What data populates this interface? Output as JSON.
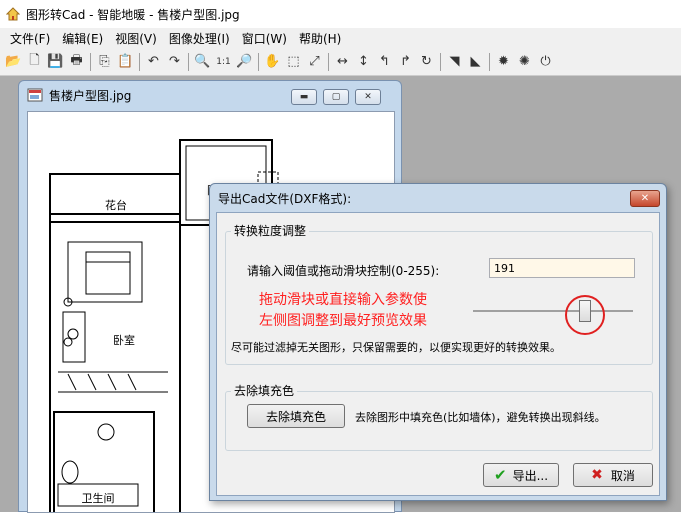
{
  "app": {
    "title": "图形转Cad - 智能地暖 - 售楼户型图.jpg"
  },
  "menu": [
    {
      "label": "文件(F)"
    },
    {
      "label": "编辑(E)"
    },
    {
      "label": "视图(V)"
    },
    {
      "label": "图像处理(I)"
    },
    {
      "label": "窗口(W)"
    },
    {
      "label": "帮助(H)"
    }
  ],
  "toolbar": {
    "icons": [
      "open-icon",
      "new-icon",
      "save-icon",
      "print-icon",
      "copy-icon",
      "paste-icon",
      "undo-icon",
      "redo-icon",
      "zoom-in-icon",
      "actual-size-icon",
      "zoom-out-icon",
      "pan-icon",
      "select-rect-icon",
      "fit-icon",
      "flip-horizontal-icon",
      "flip-vertical-icon",
      "rotate-left-icon",
      "rotate-right-icon",
      "rotate-icon",
      "crop-icon",
      "fill-icon",
      "brightness-icon",
      "contrast-icon",
      "more-icon"
    ],
    "icon_glyphs": [
      "📂",
      "🗋",
      "💾",
      "🖶",
      "⎘",
      "📋",
      "↶",
      "↷",
      "🔍",
      "1:1",
      "🔎",
      "✋",
      "⬚",
      "⤢",
      "↔",
      "↕",
      "↰",
      "↱",
      "↻",
      "◥",
      "◣",
      "✹",
      "✺",
      "⏻"
    ]
  },
  "child_window": {
    "title": "售楼户型图.jpg",
    "floorplan_labels": {
      "balcony1": "花台",
      "balcony2": "阳台",
      "bedroom": "卧室",
      "bathroom": "卫生间"
    }
  },
  "dialog": {
    "title": "导出Cad文件(DXF格式):",
    "close_label": "✕",
    "group1": {
      "legend": "转换粒度调整",
      "threshold_label": "请输入阈值或拖动滑块控制(0-255):",
      "threshold_value": "191",
      "annotation_line1": "拖动滑块或直接输入参数使",
      "annotation_line2": "左侧图调整到最好预览效果",
      "hint": "尽可能过滤掉无关图形，只保留需要的，以便实现更好的转换效果。",
      "slider_value": 191,
      "slider_max": 255
    },
    "group2": {
      "legend": "去除填充色",
      "button_label": "去除填充色",
      "description": "去除图形中填充色(比如墙体)，避免转换出现斜线。"
    },
    "export_button": {
      "icon": "✔",
      "label": "导出..."
    },
    "cancel_button": {
      "icon": "✖",
      "label": "取消"
    }
  },
  "colors": {
    "accent_red": "#ff2020",
    "check_green": "#1fa01f",
    "cancel_red": "#d02020"
  }
}
